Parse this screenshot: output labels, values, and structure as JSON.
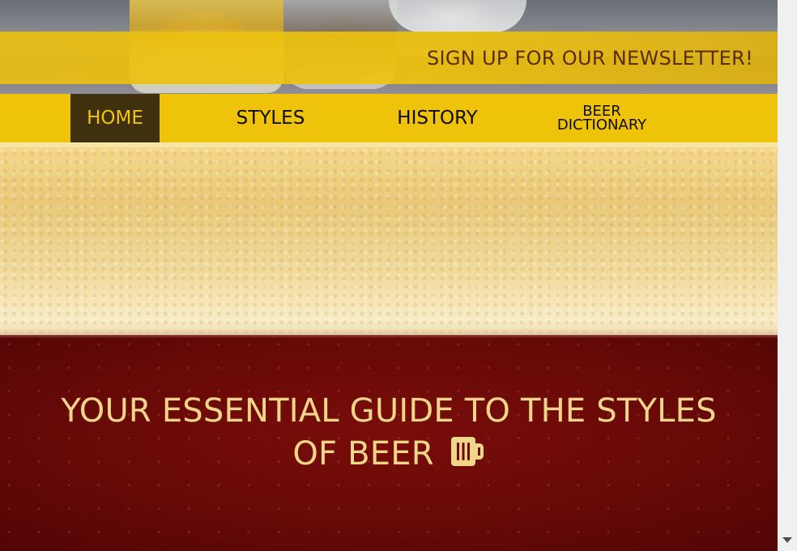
{
  "header": {
    "newsletter_label": "SIGN UP FOR OUR NEWSLETTER!"
  },
  "nav": {
    "items": [
      {
        "label": "HOME",
        "active": true
      },
      {
        "label": "STYLES",
        "active": false
      },
      {
        "label": "HISTORY",
        "active": false
      },
      {
        "label_line1": "BEER",
        "label_line2": "DICTIONARY",
        "active": false
      }
    ]
  },
  "hero": {
    "title_line1": "YOUR ESSENTIAL GUIDE TO THE STYLES",
    "title_line2": "OF BEER",
    "icon": "beer-mug-icon"
  },
  "colors": {
    "nav_background": "#f0c30b",
    "nav_active_background": "#3f300e",
    "nav_active_text": "#f2c30f",
    "hero_text": "#f1d589",
    "hero_background": "#6b0a06"
  }
}
